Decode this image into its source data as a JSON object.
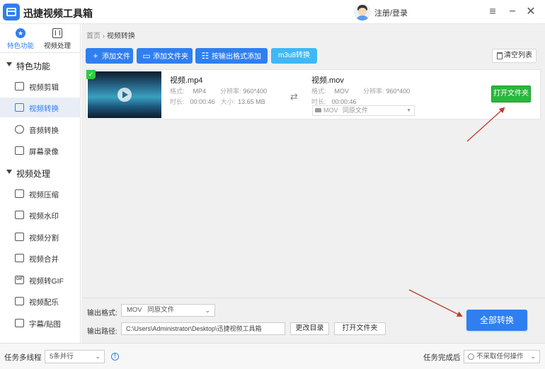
{
  "app": {
    "title": "迅捷视频工具箱",
    "login": "注册/登录"
  },
  "nav_tabs": [
    {
      "label": "特色功能",
      "active": true
    },
    {
      "label": "视频处理",
      "active": false
    }
  ],
  "sidebar": {
    "groups": [
      {
        "label": "特色功能",
        "items": [
          "视频剪辑",
          "视频转换",
          "音频转换",
          "屏幕录像"
        ]
      },
      {
        "label": "视频处理",
        "items": [
          "视频压缩",
          "视频水印",
          "视频分割",
          "视频合并",
          "视频转GIF",
          "视频配乐",
          "字幕/贴图"
        ]
      }
    ],
    "active_item": "视频转换"
  },
  "breadcrumb": {
    "home": "首页",
    "separator": "›",
    "current": "视频转换"
  },
  "toolbar": {
    "add_file": "添加文件",
    "add_folder": "添加文件夹",
    "add_by_format": "按输出格式添加",
    "m3u8": "m3u8转换",
    "clear_list": "清空列表"
  },
  "file": {
    "source": {
      "name": "视频.mp4",
      "format_label": "格式:",
      "format": "MP4",
      "resolution_label": "分辨率:",
      "resolution": "960*400",
      "duration_label": "时长:",
      "duration": "00:00:46",
      "size_label": "大小:",
      "size": "13.65 MB"
    },
    "target": {
      "name": "视频.mov",
      "format_label": "格式:",
      "format": "MOV",
      "resolution_label": "分辨率:",
      "resolution": "960*400",
      "duration_label": "时长:",
      "duration": "00:00:46",
      "select_format": "MOV",
      "select_quality": "同原文件"
    },
    "open_folder": "打开文件夹",
    "checked": "✓"
  },
  "output": {
    "format_label": "输出格式:",
    "format": "MOV",
    "quality": "同原文件",
    "path_label": "输出路径:",
    "path": "C:\\Users\\Administrator\\Desktop\\迅捷视频工具箱",
    "change_dir": "更改目录",
    "open_folder": "打开文件夹",
    "convert_all": "全部转换"
  },
  "status": {
    "multithread_label": "任务多线程",
    "thread_option": "5条并行",
    "after_label": "任务完成后",
    "after_option": "不采取任何操作"
  },
  "colors": {
    "primary": "#2f7ff0",
    "green": "#27b93d",
    "light_blue": "#3fb8f5",
    "arrow": "#c0392b"
  }
}
